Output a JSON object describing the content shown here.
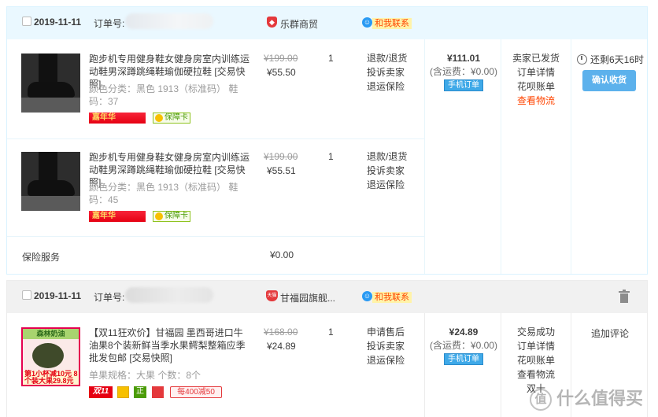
{
  "orders": [
    {
      "date": "2019-11-11",
      "order_no_label": "订单号:",
      "shop_name": "乐群商贸",
      "contact_label": "和我联系",
      "items": [
        {
          "title": "跑步机专用健身鞋女健身房室内训练运动鞋男深蹲跳绳鞋瑜伽硬拉鞋 [交易快照]",
          "meta": "颜色分类：黑色 1913（标准码）   鞋码：37",
          "badge": "嘉年华",
          "guarantee": "保障卡",
          "old_price": "¥199.00",
          "price": "¥55.50",
          "qty": "1",
          "ops": [
            "退款/退货",
            "投诉卖家",
            "退运保险"
          ]
        },
        {
          "title": "跑步机专用健身鞋女健身房室内训练运动鞋男深蹲跳绳鞋瑜伽硬拉鞋 [交易快照]",
          "meta": "颜色分类：黑色 1913（标准码）   鞋码：45",
          "badge": "嘉年华",
          "guarantee": "保障卡",
          "old_price": "¥199.00",
          "price": "¥55.51",
          "qty": "1",
          "ops": [
            "退款/退货",
            "投诉卖家",
            "退运保险"
          ]
        }
      ],
      "service": {
        "label": "保险服务",
        "price": "¥0.00"
      },
      "total": "¥111.01",
      "shipping": "(含运费：¥0.00)",
      "mobile_tag": "手机订单",
      "status_links": [
        "卖家已发货",
        "订单详情",
        "花呗账单",
        "查看物流"
      ],
      "remaining": "还剩6天16时",
      "confirm_label": "确认收货"
    },
    {
      "date": "2019-11-11",
      "order_no_label": "订单号:",
      "shop_name": "甘福园旗舰...",
      "shop_icon": "天猫",
      "contact_label": "和我联系",
      "items": [
        {
          "title": "【双11狂欢价】甘福园 墨西哥进口牛油果8个装新鲜当季水果鳄梨整箱应季批发包邮 [交易快照]",
          "meta": "单果规格：大果   个数：8个",
          "old_price": "¥168.00",
          "price": "¥24.89",
          "qty": "1",
          "ops": [
            "申请售后",
            "投诉卖家",
            "退运保险"
          ],
          "thumb_banner": "森林奶油",
          "thumb_promo": "第1小杯减10元 8个装大果29.8元",
          "tags": [
            "双11",
            "正",
            "每400减50"
          ]
        }
      ],
      "total": "¥24.89",
      "shipping": "(含运费：¥0.00)",
      "mobile_tag": "手机订单",
      "status_links": [
        "交易成功",
        "订单详情",
        "花呗账单",
        "查看物流",
        "双十"
      ],
      "review_label": "追加评论"
    }
  ],
  "watermark": "什么值得买",
  "colors": {
    "accent_red": "#ff4400",
    "header_blue": "#eaf8ff",
    "button_blue": "#5cb1ec"
  }
}
